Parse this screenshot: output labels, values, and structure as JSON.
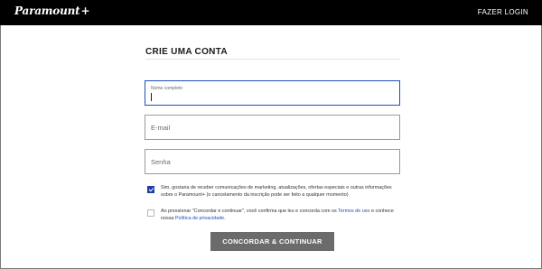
{
  "header": {
    "logo_text": "Paramount",
    "logo_plus": "+",
    "login_link": "FAZER LOGIN"
  },
  "form": {
    "title": "CRIE UMA CONTA",
    "full_name": {
      "label": "Nome completo",
      "value": ""
    },
    "email": {
      "placeholder": "E-mail"
    },
    "password": {
      "placeholder": "Senha"
    },
    "marketing_consent": {
      "checked": true,
      "text": "Sim, gostaria de receber comunicações de marketing, atualizações, ofertas especiais e outras informações sobre o Paramount+ (o cancelamento da inscrição pode ser feito a qualquer momento)"
    },
    "terms_consent": {
      "checked": false,
      "text_part1": "Ao pressionar \"Concordar e continuar\", você confirma que leu e concorda com os ",
      "terms_link": "Termos de uso",
      "text_part2": " e conhece nossa ",
      "privacy_link": "Política de privacidade",
      "text_part3": "."
    },
    "submit_label": "CONCORDAR & CONTINUAR"
  },
  "colors": {
    "topbar": "#000000",
    "focus_border": "#1b4fbd",
    "checkbox_checked": "#1b3fa6",
    "button_bg": "#6b6b6b"
  }
}
